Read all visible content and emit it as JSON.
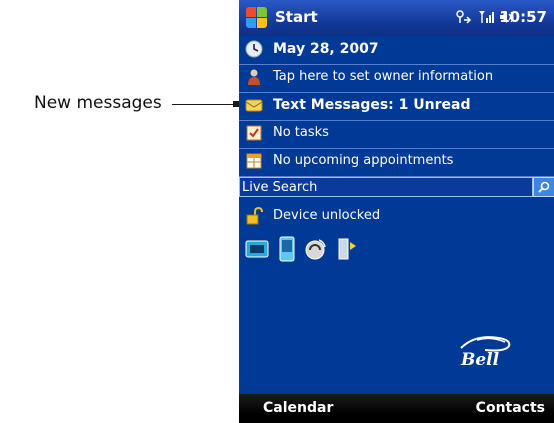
{
  "callout": {
    "label": "New messages"
  },
  "titlebar": {
    "title": "Start",
    "status_icons": "⌥ ▁▃▅ ◀⸩",
    "clock": "10:57"
  },
  "today": {
    "items": [
      {
        "icon": "clock-icon",
        "label": "May 28, 2007",
        "bold": true
      },
      {
        "icon": "owner-icon",
        "label": "Tap here to set owner information",
        "bold": false
      },
      {
        "icon": "messages-icon",
        "label": "Text Messages: 1 Unread",
        "bold": true
      },
      {
        "icon": "tasks-icon",
        "label": "No tasks",
        "bold": false
      },
      {
        "icon": "calendar-icon",
        "label": "No upcoming appointments",
        "bold": false
      }
    ],
    "search": {
      "value": "Live Search",
      "button_icon": "search-icon"
    },
    "lock": {
      "icon": "lock-icon",
      "label": "Device unlocked"
    },
    "apps": [
      "comm-manager-icon",
      "phone-icon",
      "sync-icon",
      "wireless-icon"
    ]
  },
  "brand": {
    "text": "Bell",
    "color": "#ffffff"
  },
  "softkeys": {
    "left": "Calendar",
    "right": "Contacts"
  },
  "colors": {
    "background": "#003A96",
    "titlebar": "#153a9a",
    "accent": "#1f56c8"
  }
}
